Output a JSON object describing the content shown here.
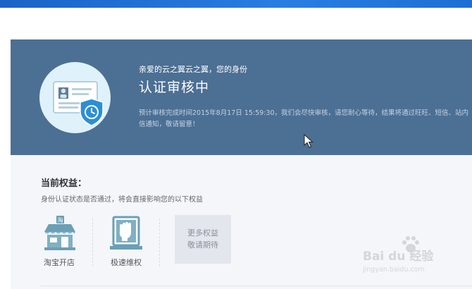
{
  "colors": {
    "banner_bg": "#4c6f94",
    "panel_bg": "#f4f6f9",
    "accent_blue": "#1a63c7",
    "icon_teal": "#6a9fb5"
  },
  "banner": {
    "greeting": "亲爱的云之翼云之翼，您的身份",
    "status_title": "认证审核中",
    "notice": "预计审核完成时间2015年8月17日 15:59:30，我们会尽快审核，请您耐心等待，结果将通过旺旺、短信、站内信通知，敬请留意！",
    "icon": "id-card-shield-clock-icon"
  },
  "benefits": {
    "title": "当前权益：",
    "description": "身份认证状态是否通过，将会直接影响您的以下权益",
    "items": [
      {
        "label": "淘宝开店",
        "icon": "taobao-store-icon",
        "icon_text": "淘"
      },
      {
        "label": "极速维权",
        "icon": "fist-rights-icon"
      }
    ],
    "more_line1": "更多权益",
    "more_line2": "敬请期待"
  },
  "watermark": {
    "main": "Bai du 经验",
    "sub": "jingyan.baidu.com"
  }
}
